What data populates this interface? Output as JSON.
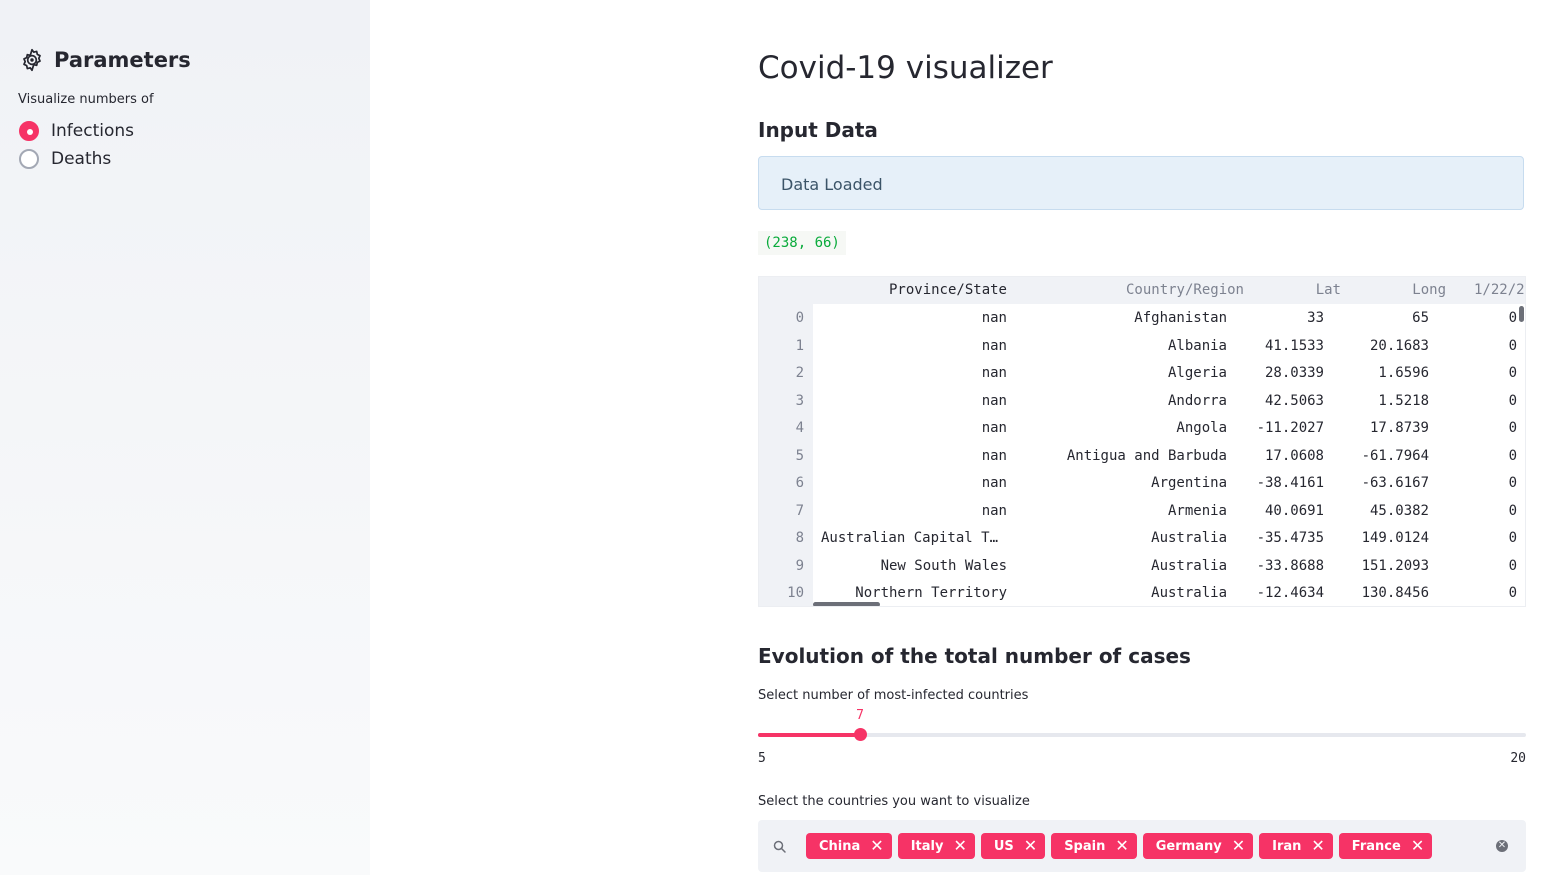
{
  "sidebar": {
    "title": "Parameters",
    "radio_label": "Visualize numbers of",
    "options": [
      {
        "label": "Infections",
        "checked": true
      },
      {
        "label": "Deaths",
        "checked": false
      }
    ]
  },
  "main": {
    "title": "Covid-19 visualizer",
    "input_header": "Input Data",
    "info_text": "Data Loaded",
    "shape": "(238, 66)",
    "evolution_header": "Evolution of the total number of cases"
  },
  "table": {
    "columns": [
      "Province/State",
      "Country/Region",
      "Lat",
      "Long",
      "1/22/2"
    ],
    "rows": [
      {
        "idx": "0",
        "prov": "nan",
        "country": "Afghanistan",
        "lat": "33",
        "long": "65",
        "d1": "0"
      },
      {
        "idx": "1",
        "prov": "nan",
        "country": "Albania",
        "lat": "41.1533",
        "long": "20.1683",
        "d1": "0"
      },
      {
        "idx": "2",
        "prov": "nan",
        "country": "Algeria",
        "lat": "28.0339",
        "long": "1.6596",
        "d1": "0"
      },
      {
        "idx": "3",
        "prov": "nan",
        "country": "Andorra",
        "lat": "42.5063",
        "long": "1.5218",
        "d1": "0"
      },
      {
        "idx": "4",
        "prov": "nan",
        "country": "Angola",
        "lat": "-11.2027",
        "long": "17.8739",
        "d1": "0"
      },
      {
        "idx": "5",
        "prov": "nan",
        "country": "Antigua and Barbuda",
        "lat": "17.0608",
        "long": "-61.7964",
        "d1": "0"
      },
      {
        "idx": "6",
        "prov": "nan",
        "country": "Argentina",
        "lat": "-38.4161",
        "long": "-63.6167",
        "d1": "0"
      },
      {
        "idx": "7",
        "prov": "nan",
        "country": "Armenia",
        "lat": "40.0691",
        "long": "45.0382",
        "d1": "0"
      },
      {
        "idx": "8",
        "prov": "Australian Capital T…",
        "country": "Australia",
        "lat": "-35.4735",
        "long": "149.0124",
        "d1": "0"
      },
      {
        "idx": "9",
        "prov": "New South Wales",
        "country": "Australia",
        "lat": "-33.8688",
        "long": "151.2093",
        "d1": "0"
      },
      {
        "idx": "10",
        "prov": "Northern Territory",
        "country": "Australia",
        "lat": "-12.4634",
        "long": "130.8456",
        "d1": "0"
      }
    ]
  },
  "slider": {
    "label": "Select number of most-infected countries",
    "value": 7,
    "value_text": "7",
    "min": 5,
    "max": 20,
    "min_text": "5",
    "max_text": "20"
  },
  "multiselect": {
    "label": "Select the countries you want to visualize",
    "tags": [
      "China",
      "Italy",
      "US",
      "Spain",
      "Germany",
      "Iran",
      "France"
    ]
  },
  "icons": {
    "sidebar_header": "gear-icon",
    "search": "search-icon",
    "tag_remove": "close-icon",
    "clear_all": "clear-icon"
  },
  "colors": {
    "accent": "#f63366",
    "sidebar_bg": "#f0f2f6",
    "info_bg": "#e6f0f9",
    "shape_text": "#09ab3b"
  }
}
